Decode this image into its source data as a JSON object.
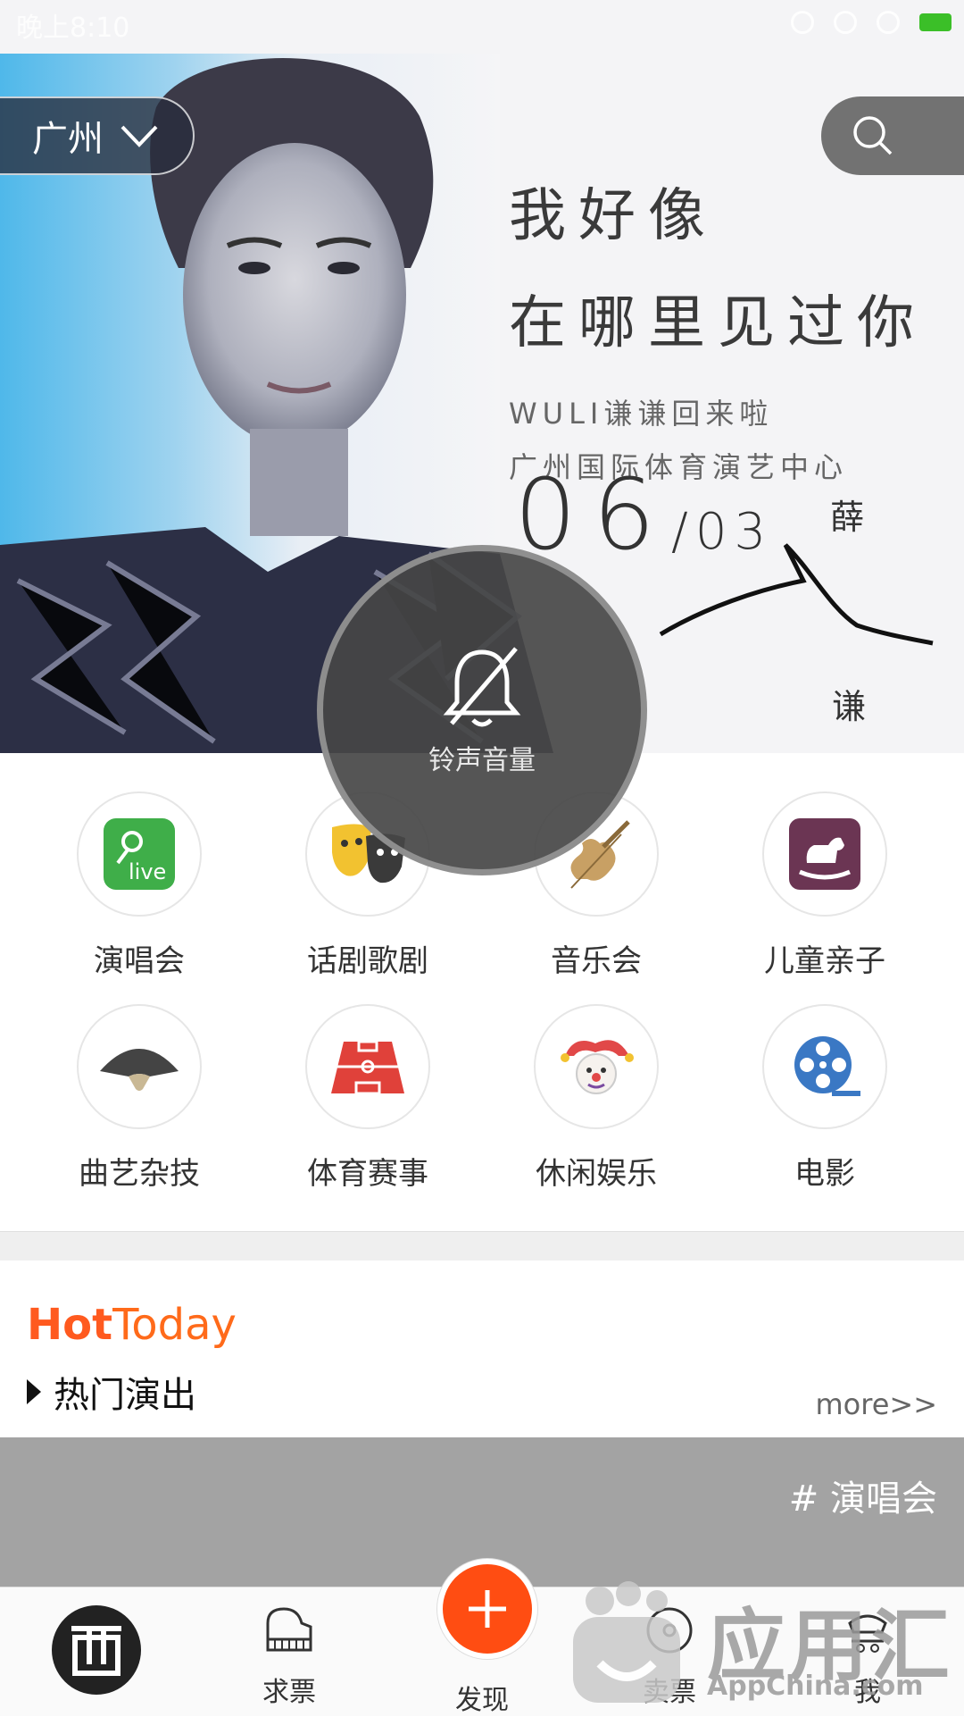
{
  "status_bar": {
    "time": "晚上8:10"
  },
  "banner": {
    "city": "广州",
    "line1": "我好像",
    "line2": "在哪里见过你",
    "line3": "WULI谦谦回来啦",
    "line4": "广州国际体育演艺中心",
    "date_big": "06",
    "date_sep": "/",
    "date_small": "03",
    "sig_top": "薛",
    "sig_bottom": "谦"
  },
  "volume_overlay": {
    "label": "铃声音量",
    "icon": "bell-muted-icon"
  },
  "categories": [
    {
      "label": "演唱会",
      "icon": "live-mic-icon",
      "color": "#3fae49"
    },
    {
      "label": "话剧歌剧",
      "icon": "theater-masks-icon",
      "color": "#f2c230"
    },
    {
      "label": "音乐会",
      "icon": "violin-icon",
      "color": "#c8a064"
    },
    {
      "label": "儿童亲子",
      "icon": "rocking-horse-icon",
      "color": "#6b3553"
    },
    {
      "label": "曲艺杂技",
      "icon": "folding-fan-icon",
      "color": "#444444"
    },
    {
      "label": "体育赛事",
      "icon": "football-field-icon",
      "color": "#e0413a"
    },
    {
      "label": "休闲娱乐",
      "icon": "jester-icon",
      "color": "#e14848"
    },
    {
      "label": "电影",
      "icon": "film-reel-icon",
      "color": "#3a78c4"
    }
  ],
  "hot_today": {
    "title_a": "Hot",
    "title_b": "Today",
    "subtitle": "热门演出",
    "more": "more>>",
    "card_tag": "# 演唱会"
  },
  "bottom_nav": {
    "tickets_request": "求票",
    "discover": "发现",
    "sell": "卖票",
    "me": "我"
  },
  "watermark": {
    "big": "应用汇",
    "small": "AppChina.com"
  },
  "colors": {
    "accent": "#ff5a1f",
    "fab": "#ff4d12"
  }
}
